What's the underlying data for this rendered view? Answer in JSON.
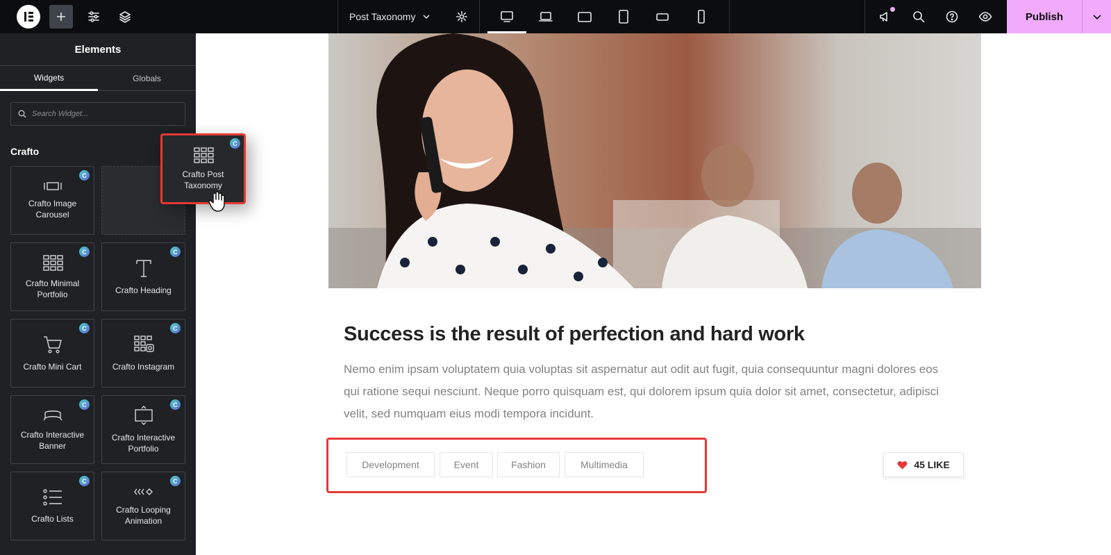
{
  "topbar": {
    "document_title": "Post Taxonomy",
    "publish_label": "Publish",
    "icons": [
      "elementor-logo-icon",
      "add-element-icon",
      "site-settings-icon",
      "structure-icon",
      "page-settings-icon",
      "desktop-icon",
      "laptop-icon",
      "tablet-landscape-icon",
      "tablet-portrait-icon",
      "mobile-landscape-icon",
      "mobile-portrait-icon",
      "notifications-icon",
      "search-icon",
      "help-icon",
      "preview-icon",
      "chevron-down-icon"
    ],
    "accent_color": "#f0abfc"
  },
  "panel": {
    "title": "Elements",
    "tabs": [
      {
        "label": "Widgets",
        "active": true
      },
      {
        "label": "Globals",
        "active": false
      }
    ],
    "search_placeholder": "Search Widget...",
    "category": "Crafto",
    "widgets": [
      {
        "label": "Crafto Image Carousel",
        "icon": "image-carousel-icon"
      },
      {
        "label": "Crafto Minimal Portfolio",
        "icon": "grid-icon"
      },
      {
        "label": "Crafto Heading",
        "icon": "heading-icon"
      },
      {
        "label": "Crafto Mini Cart",
        "icon": "cart-icon"
      },
      {
        "label": "Crafto Instagram",
        "icon": "instagram-grid-icon"
      },
      {
        "label": "Crafto Interactive Banner",
        "icon": "banner-icon"
      },
      {
        "label": "Crafto Interactive Portfolio",
        "icon": "interactive-portfolio-icon"
      },
      {
        "label": "Crafto Lists",
        "icon": "list-icon"
      },
      {
        "label": "Crafto Looping Animation",
        "icon": "looping-animation-icon"
      }
    ],
    "badge_letter": "C",
    "dragged_widget": {
      "label": "Crafto Post Taxonomy",
      "icon": "grid-icon"
    }
  },
  "canvas": {
    "article_title": "Success is the result of perfection and hard work",
    "article_body": "Nemo enim ipsam voluptatem quia voluptas sit aspernatur aut odit aut fugit, quia consequuntur magni dolores eos qui ratione sequi nesciunt. Neque porro quisquam est, qui dolorem ipsum quia dolor sit amet, consectetur, adipisci velit, sed numquam eius modi tempora incidunt.",
    "tags": [
      "Development",
      "Event",
      "Fashion",
      "Multimedia"
    ],
    "like_label": "45 LIKE",
    "like_color": "#e53935",
    "highlight_color": "#e53935"
  }
}
